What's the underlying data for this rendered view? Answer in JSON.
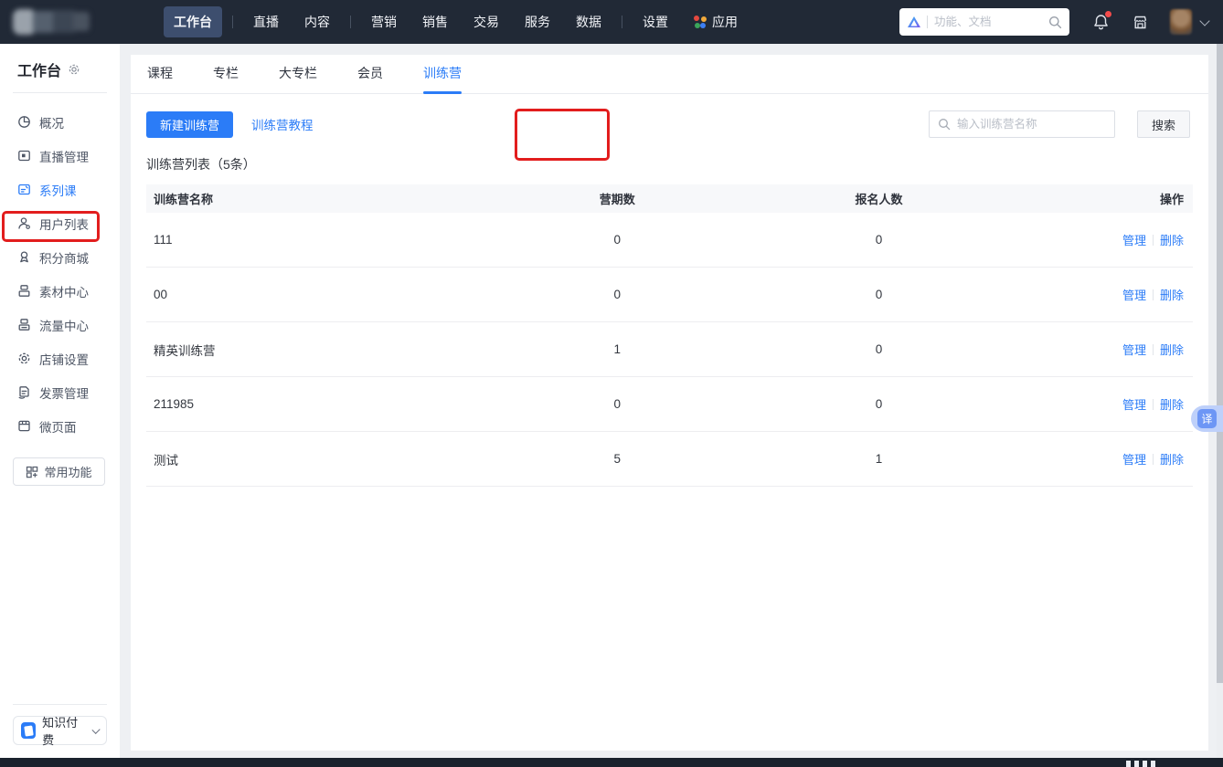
{
  "colors": {
    "accent_blue": "#2b7cf7",
    "annotation_red": "#e21d1d",
    "navbar_bg": "#212936"
  },
  "navbar": {
    "menu": [
      {
        "label": "工作台",
        "active": true
      },
      {
        "label": "直播"
      },
      {
        "label": "内容"
      },
      {
        "label": "营销"
      },
      {
        "label": "销售"
      },
      {
        "label": "交易"
      },
      {
        "label": "服务"
      },
      {
        "label": "数据"
      },
      {
        "label": "设置"
      },
      {
        "label": "应用"
      }
    ],
    "search_placeholder": "功能、文档"
  },
  "sidebar": {
    "title": "工作台",
    "items": [
      {
        "label": "概况"
      },
      {
        "label": "直播管理"
      },
      {
        "label": "系列课",
        "active": true
      },
      {
        "label": "用户列表"
      },
      {
        "label": "积分商城"
      },
      {
        "label": "素材中心"
      },
      {
        "label": "流量中心"
      },
      {
        "label": "店铺设置"
      },
      {
        "label": "发票管理"
      },
      {
        "label": "微页面"
      }
    ],
    "quick_button": "常用功能",
    "app_switcher": "知识付费"
  },
  "tabs": [
    {
      "label": "课程"
    },
    {
      "label": "专栏"
    },
    {
      "label": "大专栏"
    },
    {
      "label": "会员"
    },
    {
      "label": "训练营",
      "active": true
    }
  ],
  "toolbar": {
    "new_button": "新建训练营",
    "tutorial_link": "训练营教程",
    "search_placeholder": "输入训练营名称",
    "search_button": "搜索"
  },
  "list": {
    "title": "训练营列表（5条）",
    "columns": [
      "训练营名称",
      "营期数",
      "报名人数",
      "操作"
    ],
    "action_manage": "管理",
    "action_delete": "删除",
    "rows": [
      {
        "name": "111",
        "periods": "0",
        "signups": "0"
      },
      {
        "name": "00",
        "periods": "0",
        "signups": "0"
      },
      {
        "name": "精英训练营",
        "periods": "1",
        "signups": "0"
      },
      {
        "name": "211985",
        "periods": "0",
        "signups": "0"
      },
      {
        "name": "测试",
        "periods": "5",
        "signups": "1"
      }
    ]
  },
  "floating": {
    "translate_button": "译"
  }
}
